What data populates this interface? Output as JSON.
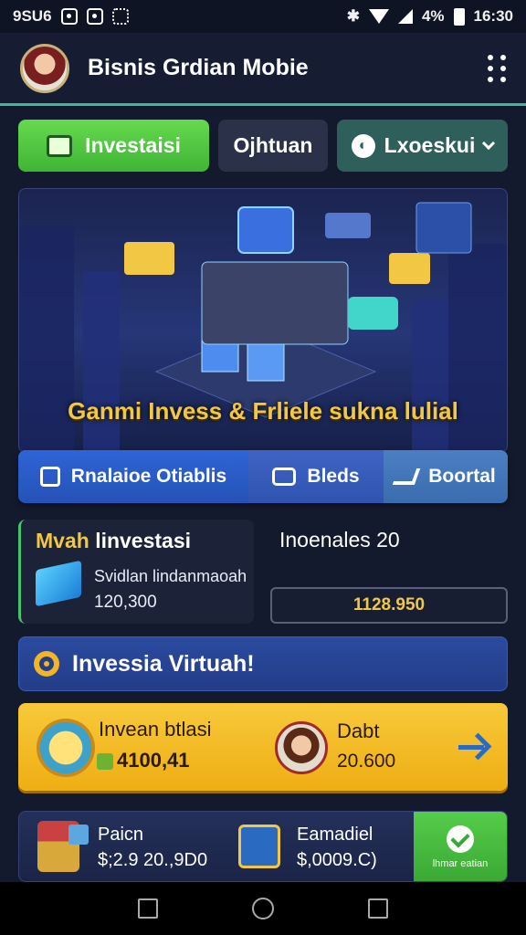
{
  "status_bar": {
    "left_text": "9SU6",
    "time": "16:30",
    "battery": "4%"
  },
  "app_bar": {
    "title": "Bisnis Grdian Mobie"
  },
  "tabs": [
    {
      "label": "Investaisi"
    },
    {
      "label": "Ojhtuan"
    },
    {
      "label": "Lxoeskui"
    }
  ],
  "hero": {
    "caption": "Ganmi Invess & Frliele sukna lulial"
  },
  "actions": [
    {
      "label": "Rnalaioe Otiablis"
    },
    {
      "label": "Bleds"
    },
    {
      "label": "Boortal"
    }
  ],
  "my_investments": {
    "title_prefix": "Mvah",
    "title_rest": "linvestasi",
    "subtitle": "Svidlan lindanmaoah",
    "value": "120,300"
  },
  "right_panel": {
    "title": "Inoenales 20",
    "value": "1128.950"
  },
  "banner": {
    "label": "Invessia Virtuah!"
  },
  "promo": {
    "left_title": "Invean btlasi",
    "left_value": "4100,41",
    "right_title": "Dabt",
    "right_value": "20.600"
  },
  "bottom_card": {
    "item1_title": "Paicn",
    "item1_value": "$;2.9 20.,9D0",
    "item2_title": "Eamadiel",
    "item2_value": "$,0009.C)",
    "button_label": "lhmar eatian"
  },
  "colors": {
    "accent_green": "#49c26d",
    "accent_gold": "#f2c744",
    "banner_blue": "#2b4aa0",
    "background": "#141a2e"
  }
}
